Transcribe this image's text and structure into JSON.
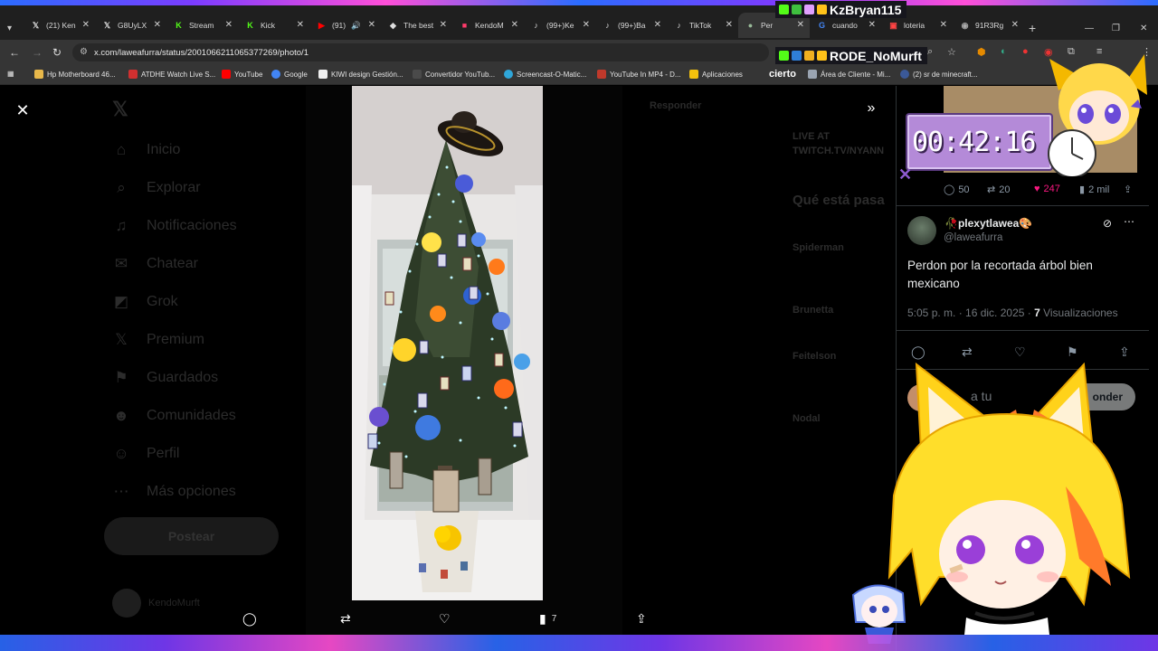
{
  "browser": {
    "tabs": [
      {
        "label": "(21) Ken",
        "icon": "x-icon",
        "active": false
      },
      {
        "label": "G8UyLX",
        "icon": "x-icon",
        "active": false
      },
      {
        "label": "Stream",
        "icon": "kick-icon",
        "active": false
      },
      {
        "label": "Kick",
        "icon": "kick-icon",
        "active": false
      },
      {
        "label": "(91)",
        "icon": "youtube-icon",
        "active": false
      },
      {
        "label": "The best",
        "icon": "site-icon",
        "active": false
      },
      {
        "label": "KendoM",
        "icon": "site-icon",
        "active": false
      },
      {
        "label": "(99+)Ke",
        "icon": "tiktok-icon",
        "active": false
      },
      {
        "label": "(99+)Ba",
        "icon": "tiktok-icon",
        "active": false
      },
      {
        "label": "TikTok",
        "icon": "tiktok-icon",
        "active": false
      },
      {
        "label": "Per",
        "icon": "site-icon",
        "active": true
      },
      {
        "label": "cuando",
        "icon": "google-icon",
        "active": false
      },
      {
        "label": "loteria",
        "icon": "site-icon",
        "active": false
      },
      {
        "label": "91R3Rg",
        "icon": "site-icon",
        "active": false
      }
    ],
    "url": "x.com/laweafurra/status/2001066211065377269/photo/1",
    "bookmarks": [
      {
        "label": "Hp Motherboard 46...",
        "color": "#e8b84a"
      },
      {
        "label": "ATDHE Watch Live S...",
        "color": "#d03030"
      },
      {
        "label": "YouTube",
        "color": "#ff0000"
      },
      {
        "label": "Google",
        "color": "#4285f4"
      },
      {
        "label": "KIWI design Gestión...",
        "color": "#f0f0f0"
      },
      {
        "label": "Convertidor YouTub...",
        "color": "#4a4a4a"
      },
      {
        "label": "Screencast-O-Matic...",
        "color": "#2fa6d9"
      },
      {
        "label": "YouTube In MP4 - D...",
        "color": "#c0392b"
      },
      {
        "label": "Aplicaciones",
        "color": "#f4c20d"
      },
      {
        "label": "Área de Cliente - Mi...",
        "color": "#9aa4b1"
      },
      {
        "label": "(2) sr de minecraft...",
        "color": "#3b5998"
      }
    ]
  },
  "left_nav": {
    "items": [
      {
        "label": "Inicio",
        "icon": "home-icon"
      },
      {
        "label": "Explorar",
        "icon": "search-icon"
      },
      {
        "label": "Notificaciones",
        "icon": "bell-icon"
      },
      {
        "label": "Chatear",
        "icon": "mail-icon"
      },
      {
        "label": "Grok",
        "icon": "grok-icon"
      },
      {
        "label": "Premium",
        "icon": "x-icon"
      },
      {
        "label": "Guardados",
        "icon": "bookmark-icon"
      },
      {
        "label": "Comunidades",
        "icon": "people-icon"
      },
      {
        "label": "Perfil",
        "icon": "person-icon"
      },
      {
        "label": "Más opciones",
        "icon": "more-icon"
      }
    ],
    "post_label": "Postear",
    "account_name": "KendoMurft"
  },
  "background": {
    "reply_label": "Responder",
    "live_label": "LIVE AT",
    "live_url": "TWITCH.TV/NYANN",
    "trending_title": "Qué está pasa",
    "trends": [
      "Spiderman",
      "Brunetta",
      "Feitelson",
      "Nodal"
    ]
  },
  "media": {
    "close_icon": "close-icon",
    "expand_icon": "expand-icon",
    "views": "7"
  },
  "previous_tweet": {
    "replies": "50",
    "reposts": "20",
    "likes": "247",
    "views": "2 mil"
  },
  "tweet": {
    "author_name": "plexytlawea",
    "author_emoji": "🎨",
    "author_prefix": "🥀",
    "handle": "@laweafurra",
    "text": "Perdon por la recortada árbol bien mexicano",
    "time": "5:05 p. m. · 16 dic. 2025 · ",
    "views_count": "7",
    "views_label": " Visualizaciones",
    "reply_placeholder": "a tu",
    "reply_button": "onder"
  },
  "stream_overlay": {
    "donor_1": "KzBryan115",
    "donor_2": "RODE_NoMurft",
    "chat_word": "cierto",
    "timer": "00:42:16"
  },
  "colors": {
    "like_pink": "#f91880",
    "muted": "#71767b",
    "timer_purple": "#b48ad8"
  }
}
